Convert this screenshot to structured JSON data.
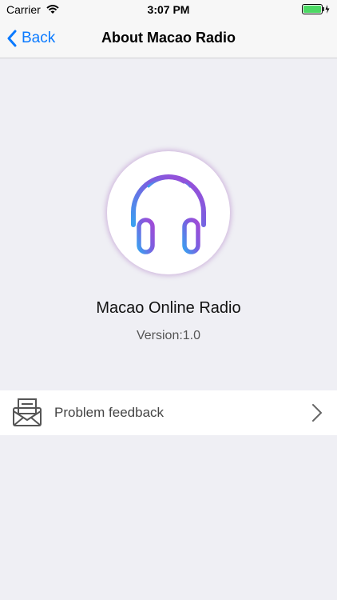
{
  "status_bar": {
    "carrier": "Carrier",
    "time": "3:07 PM",
    "battery_color": "#4cd964"
  },
  "nav": {
    "back_label": "Back",
    "title": "About Macao Radio",
    "accent_color": "#0a7aff"
  },
  "app": {
    "logo_icon": "headphones-icon",
    "name": "Macao Online Radio",
    "version": "Version:1.0"
  },
  "feedback": {
    "icon": "mail-icon",
    "label": "Problem feedback"
  }
}
